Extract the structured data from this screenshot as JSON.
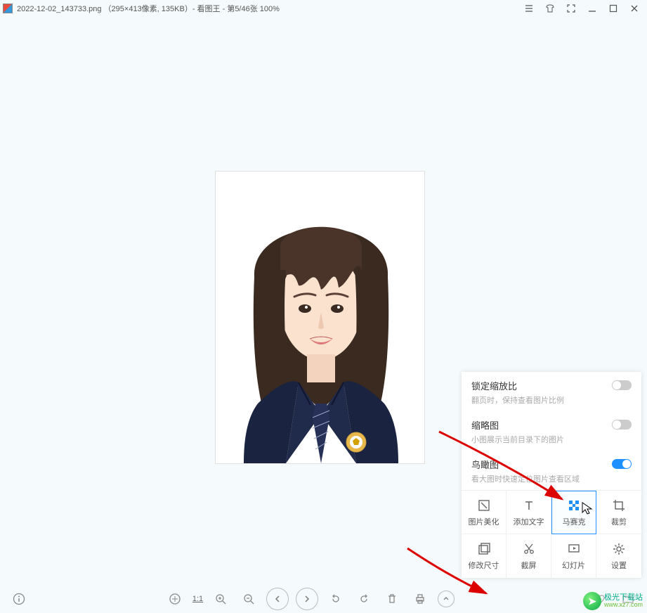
{
  "title": "2022-12-02_143733.png （295×413像素, 135KB）- 看图王 - 第5/46张 100%",
  "panel": {
    "lockZoom": {
      "title": "锁定缩放比",
      "desc": "翻页时，保持查看图片比例",
      "on": false
    },
    "thumb": {
      "title": "缩略图",
      "desc": "小图展示当前目录下的图片",
      "on": false
    },
    "birdview": {
      "title": "鸟瞰图",
      "desc": "看大图时快速定位图片查看区域",
      "on": true
    }
  },
  "tools": {
    "beautify": "图片美化",
    "addtext": "添加文字",
    "mosaic": "马赛克",
    "crop": "裁剪",
    "resize": "修改尺寸",
    "screenshot": "截屏",
    "slideshow": "幻灯片",
    "settings": "设置"
  },
  "bottom": {
    "ratio": "1:1"
  },
  "watermark": {
    "cn": "极光下载站",
    "en": "www.xz7.com"
  }
}
